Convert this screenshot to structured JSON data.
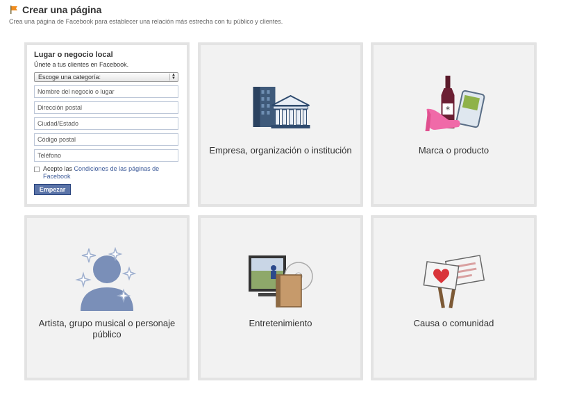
{
  "header": {
    "title": "Crear una página",
    "subtitle": "Crea una página de Facebook para establecer una relación más estrecha con tu público y clientes."
  },
  "local_form": {
    "title": "Lugar o negocio local",
    "subtitle": "Únete a tus clientes en Facebook.",
    "category_select": "Escoge una categoría:",
    "fields": {
      "name": "Nombre del negocio o lugar",
      "address": "Dirección postal",
      "city": "Ciudad/Estado",
      "postal": "Código postal",
      "phone": "Teléfono"
    },
    "terms_prefix": "Acepto las ",
    "terms_link": "Condiciones de las páginas de Facebook",
    "submit": "Empezar"
  },
  "categories": {
    "company": "Empresa, organización o institución",
    "brand": "Marca o producto",
    "artist": "Artista, grupo musical o personaje público",
    "entertainment": "Entretenimiento",
    "cause": "Causa o comunidad"
  },
  "icons": {
    "flag": "flag-icon",
    "company": "buildings-icon",
    "brand": "products-icon",
    "artist": "silhouette-icon",
    "entertainment": "media-icon",
    "cause": "signs-icon"
  },
  "colors": {
    "link": "#3b5998",
    "button": "#5b74a8",
    "tile_bg": "#f2f2f2",
    "tile_border": "#e3e3e3"
  }
}
